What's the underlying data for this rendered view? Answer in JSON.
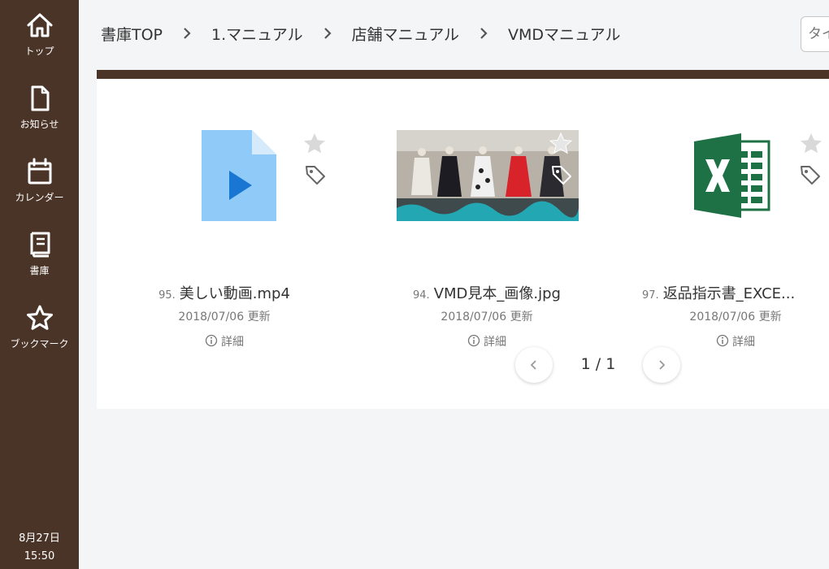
{
  "sidebar": {
    "items": [
      {
        "label": "トップ",
        "icon": "home-icon"
      },
      {
        "label": "お知らせ",
        "icon": "document-icon"
      },
      {
        "label": "カレンダー",
        "icon": "calendar-icon"
      },
      {
        "label": "書庫",
        "icon": "book-icon"
      },
      {
        "label": "ブックマーク",
        "icon": "star-icon"
      }
    ],
    "clock": {
      "date": "8月27日",
      "time": "15:50"
    }
  },
  "header": {
    "breadcrumb": [
      "書庫TOP",
      "1.マニュアル",
      "店舗マニュアル",
      "VMDマニュアル"
    ],
    "search_placeholder": "タイ"
  },
  "files": [
    {
      "number": "95.",
      "name": "美しい動画.mp4",
      "date": "2018/07/06 更新",
      "detail_label": "詳細",
      "type": "video"
    },
    {
      "number": "94.",
      "name": "VMD見本_画像.jpg",
      "date": "2018/07/06 更新",
      "detail_label": "詳細",
      "type": "image"
    },
    {
      "number": "97.",
      "name": "返品指示書_EXCE...",
      "date": "2018/07/06 更新",
      "detail_label": "詳細",
      "type": "excel"
    }
  ],
  "pagination": {
    "text": "1 / 1"
  },
  "colors": {
    "sidebar": "#4a3427",
    "accent": "#4a3427",
    "excel_green": "#1e7145",
    "video_blue": "#90caf9"
  }
}
